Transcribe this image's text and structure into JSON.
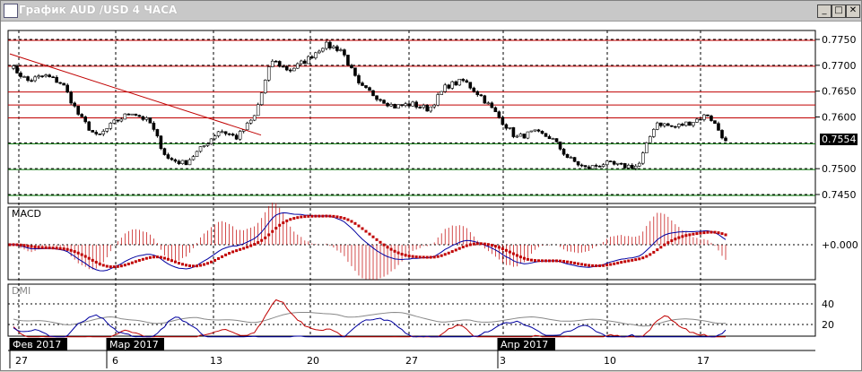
{
  "window": {
    "title": "График AUD /USD  4 ЧАСА",
    "minimize": "_",
    "maximize": "□",
    "close": "✕"
  },
  "price_scale": {
    "ticks": [
      "0.7750",
      "0.7700",
      "0.7650",
      "0.7600",
      "0.7500",
      "0.7450"
    ],
    "current": "0.7554"
  },
  "panels": {
    "macd": "MACD",
    "macd_zero": "+0.000",
    "dmi": "DMI",
    "dmi_40": "40",
    "dmi_20": "20"
  },
  "dates": [
    "27",
    "6",
    "13",
    "20",
    "27",
    "3",
    "10",
    "17"
  ],
  "months": [
    "Фев 2017",
    "Мар 2017",
    "Апр 2017"
  ],
  "chart_data": {
    "type": "candlestick",
    "symbol": "AUD/USD",
    "timeframe": "4H",
    "close_keypoints": [
      0.77,
      0.767,
      0.768,
      0.7665,
      0.76,
      0.756,
      0.759,
      0.761,
      0.759,
      0.752,
      0.751,
      0.754,
      0.7575,
      0.756,
      0.76,
      0.771,
      0.769,
      0.771,
      0.774,
      0.773,
      0.766,
      0.764,
      0.762,
      0.7625,
      0.7615,
      0.766,
      0.767,
      0.764,
      0.76,
      0.756,
      0.757,
      0.756,
      0.752,
      0.75,
      0.751,
      0.7505,
      0.7505,
      0.759,
      0.758,
      0.759,
      0.7605,
      0.7554
    ],
    "red_levels": [
      0.775,
      0.77,
      0.765,
      0.7625,
      0.76
    ],
    "green_levels": [
      0.755,
      0.75,
      0.745
    ],
    "ylim": [
      0.743,
      0.7765
    ]
  },
  "colors": {
    "red": "#c00000",
    "green": "#007000",
    "blue": "#0000a0"
  }
}
